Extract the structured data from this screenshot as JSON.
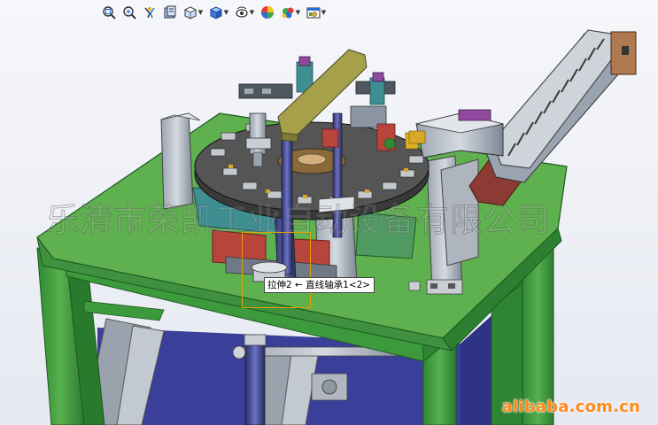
{
  "toolbar": {
    "buttons": [
      {
        "icon": "zoom-to-fit-icon",
        "dropdown": false
      },
      {
        "icon": "zoom-to-area-icon",
        "dropdown": false
      },
      {
        "icon": "previous-view-icon",
        "dropdown": false
      },
      {
        "icon": "section-view-icon",
        "dropdown": false
      },
      {
        "icon": "view-orientation-icon",
        "dropdown": true
      },
      {
        "icon": "display-style-icon",
        "dropdown": true
      },
      {
        "icon": "hide-show-items-icon",
        "dropdown": true
      },
      {
        "icon": "edit-appearance-icon",
        "dropdown": false
      },
      {
        "icon": "apply-scene-icon",
        "dropdown": true
      },
      {
        "icon": "view-settings-icon",
        "dropdown": true
      }
    ]
  },
  "watermark": {
    "text": "乐清市荣凯工业自动设备有限公司"
  },
  "tooltip": {
    "text": "拉伸2 ← 直线轴承1<2>"
  },
  "site_mark": {
    "text": "alibaba.com.cn"
  },
  "colors": {
    "frame_green": "#3c9a3c",
    "tabletop_green": "#5fb04f",
    "navy_panel": "#3a3f9a",
    "steel_grey": "#8b95a3",
    "dark_turntable": "#4a4a4a",
    "olive_arm": "#a6a04a",
    "teal_block": "#3f8f92",
    "red_accent": "#b8453c",
    "highlight_orange": "#e2a000",
    "brand_orange": "#ff8a1c"
  }
}
